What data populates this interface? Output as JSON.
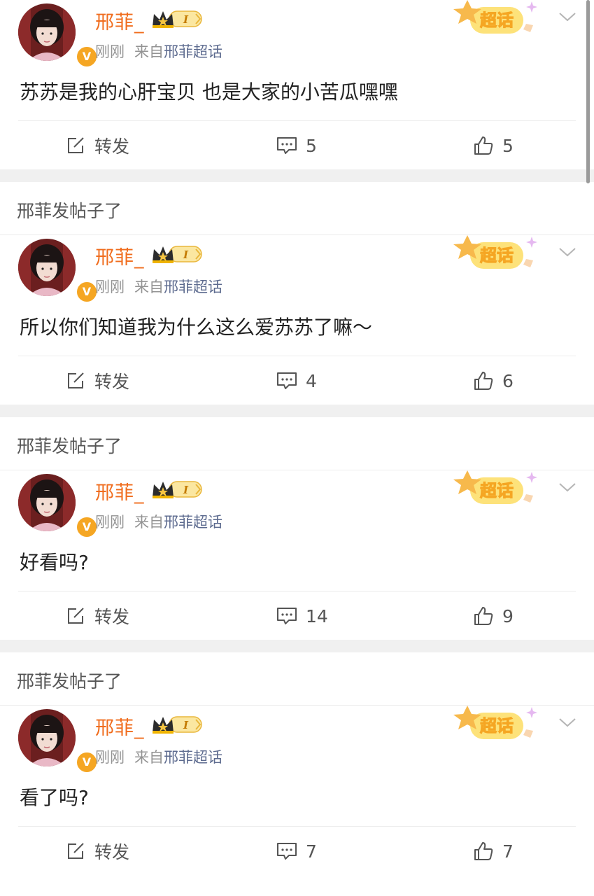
{
  "section_title": "邢菲发帖子了",
  "icons": {
    "repost": "share-edit-icon",
    "comment": "comment-icon",
    "like": "thumbs-up-icon",
    "menu": "chevron-down-icon",
    "crown": "crown-level-icon",
    "verified": "verified-badge-icon",
    "supertopic": "chaohua-badge-icon"
  },
  "colors": {
    "username": "#f06d1e",
    "source_link": "#5d6b8f",
    "meta": "#939393",
    "badge": "#f5c542",
    "separator": "#f0f0f0"
  },
  "posts": [
    {
      "author": "邢菲_",
      "level": "I",
      "time": "刚刚",
      "from_label": "来自",
      "source": "邢菲超话",
      "badge_text": "超话",
      "text": "苏苏是我的心肝宝贝 也是大家的小苦瓜嘿嘿",
      "repost_label": "转发",
      "comments": "5",
      "likes": "5"
    },
    {
      "author": "邢菲_",
      "level": "I",
      "time": "刚刚",
      "from_label": "来自",
      "source": "邢菲超话",
      "badge_text": "超话",
      "text": "所以你们知道我为什么这么爱苏苏了嘛～",
      "repost_label": "转发",
      "comments": "4",
      "likes": "6"
    },
    {
      "author": "邢菲_",
      "level": "I",
      "time": "刚刚",
      "from_label": "来自",
      "source": "邢菲超话",
      "badge_text": "超话",
      "text": "好看吗?",
      "repost_label": "转发",
      "comments": "14",
      "likes": "9"
    },
    {
      "author": "邢菲_",
      "level": "I",
      "time": "刚刚",
      "from_label": "来自",
      "source": "邢菲超话",
      "badge_text": "超话",
      "text": "看了吗?",
      "repost_label": "转发",
      "comments": "7",
      "likes": "7"
    }
  ]
}
